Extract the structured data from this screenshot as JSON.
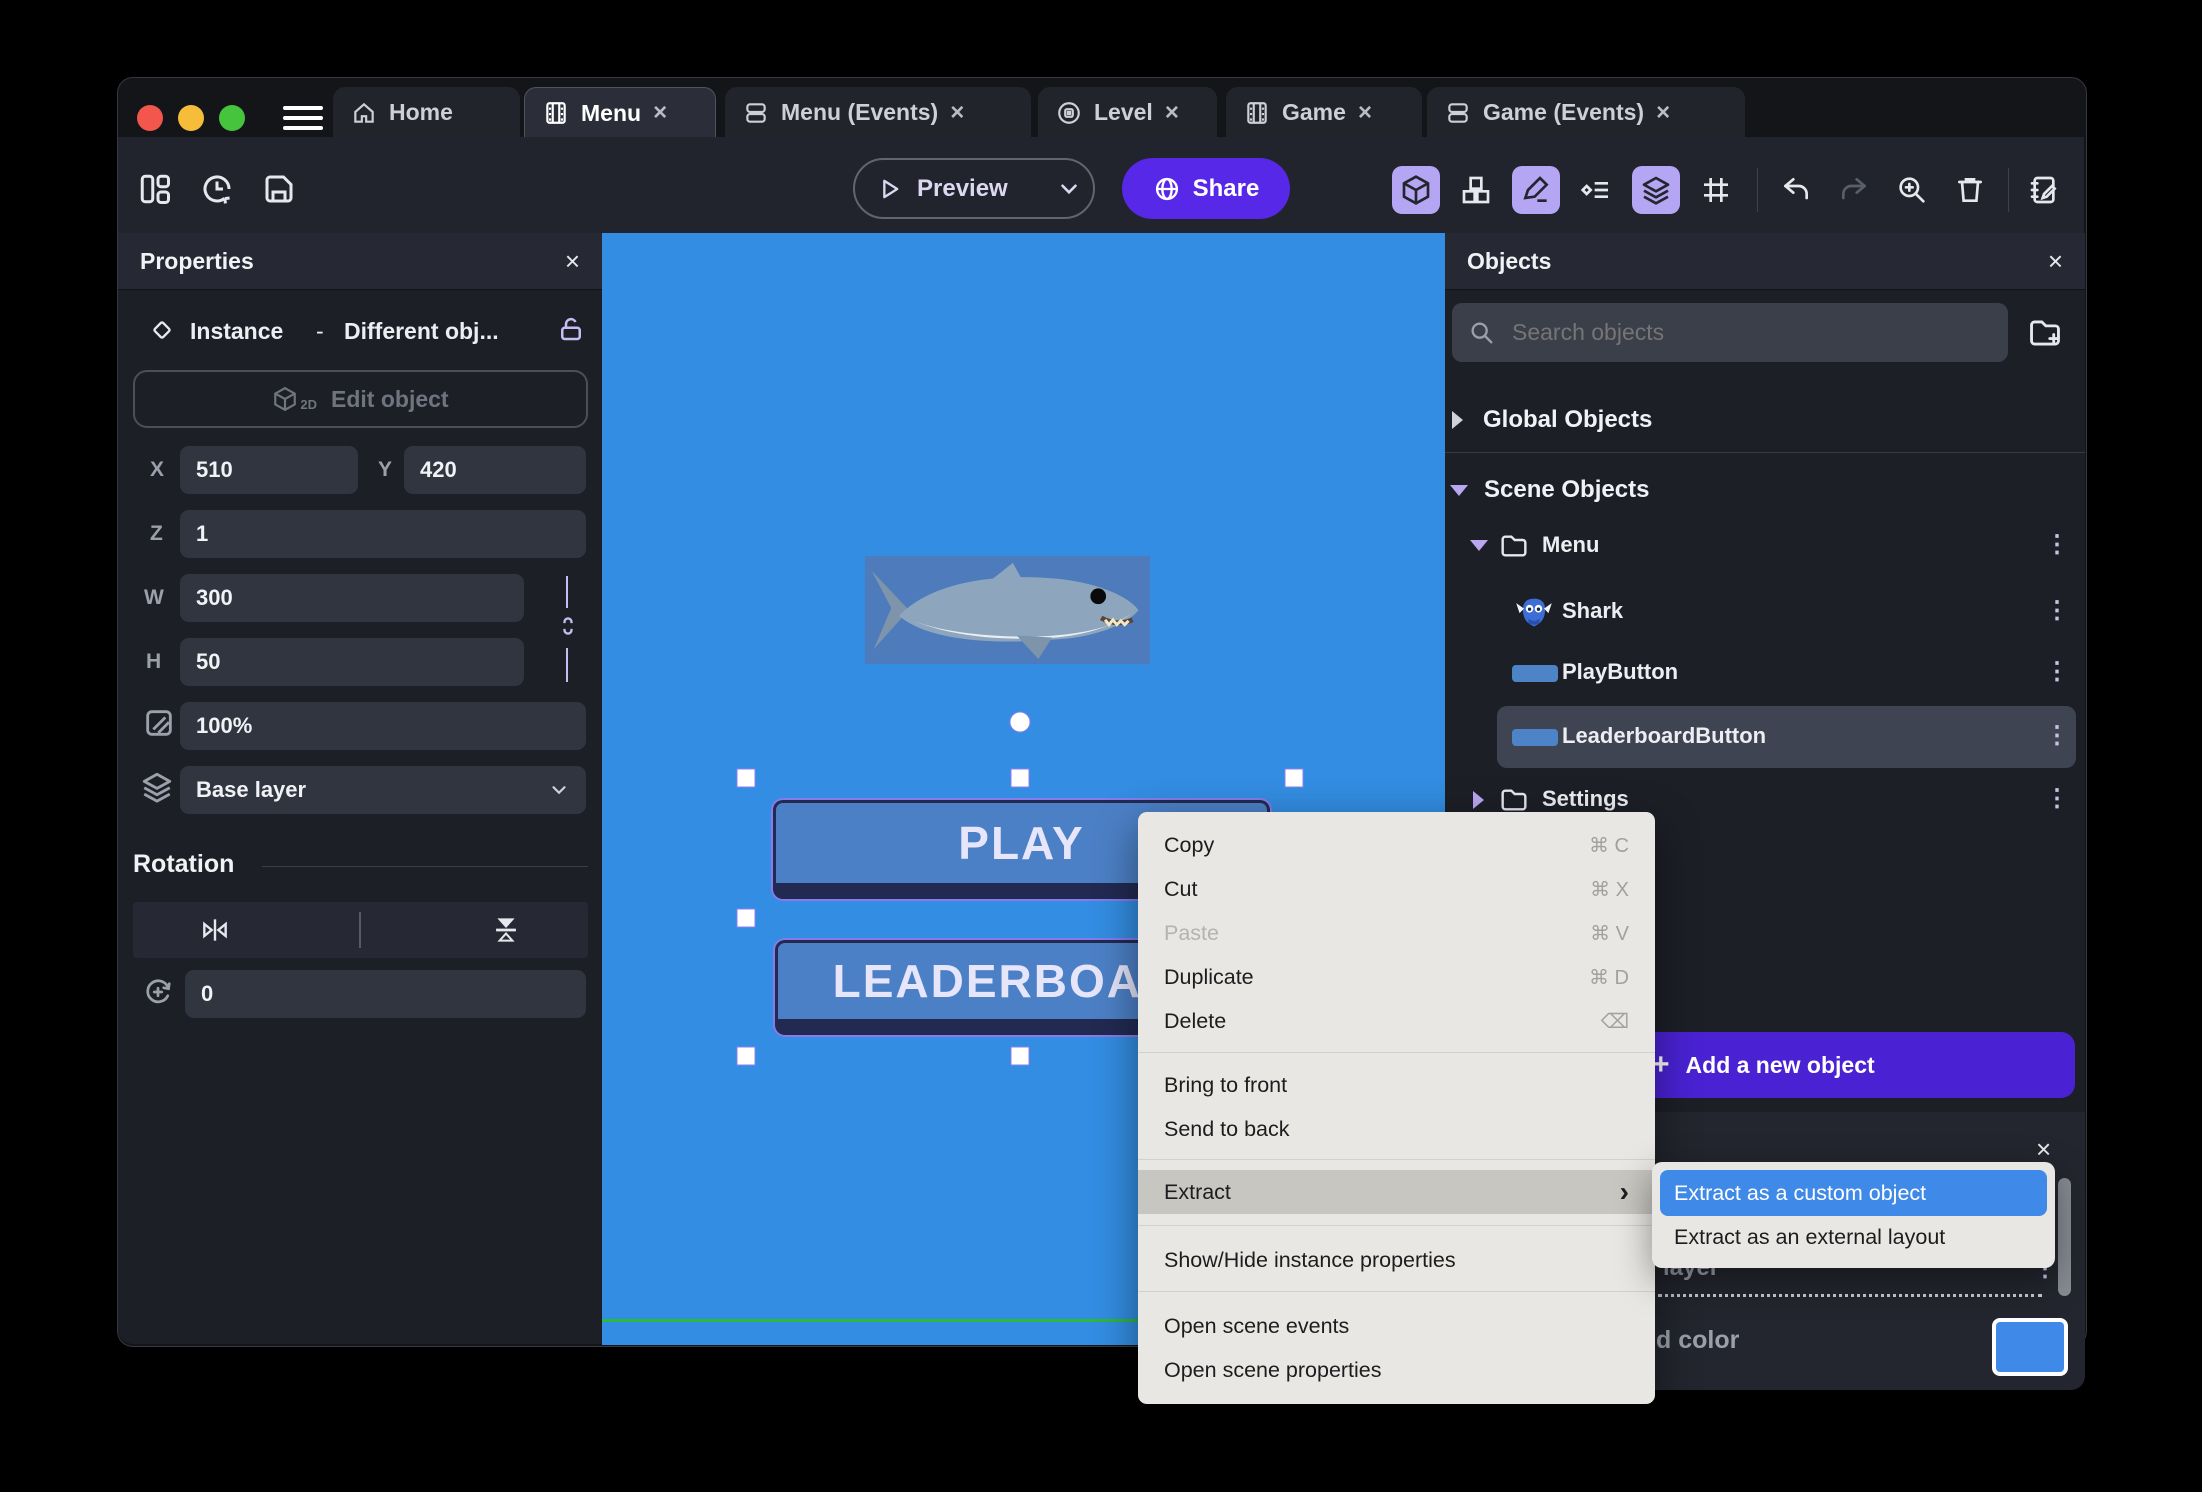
{
  "icons": {
    "close": "×",
    "kebab": "⋮",
    "arrow_right": "›",
    "plus": "+"
  },
  "titlebar": {
    "tabs": [
      {
        "label": "Home"
      },
      {
        "label": "Menu"
      },
      {
        "label": "Menu (Events)"
      },
      {
        "label": "Level"
      },
      {
        "label": "Game"
      },
      {
        "label": "Game (Events)"
      }
    ]
  },
  "toolbar": {
    "preview_label": "Preview",
    "share_label": "Share"
  },
  "properties": {
    "title": "Properties",
    "instance_label": "Instance",
    "instance_sep": "-",
    "instance_object": "Different obj...",
    "edit_object_label": "Edit object",
    "edit_object_badge": "2D",
    "x_label": "X",
    "x_value": "510",
    "y_label": "Y",
    "y_value": "420",
    "z_label": "Z",
    "z_value": "1",
    "w_label": "W",
    "w_value": "300",
    "h_label": "H",
    "h_value": "50",
    "opacity_value": "100%",
    "layer_value": "Base layer",
    "rotation_heading": "Rotation",
    "rotation_value": "0"
  },
  "canvas": {
    "play_label": "PLAY",
    "leaderboard_label": "LEADERBOARD"
  },
  "objects": {
    "title": "Objects",
    "search_placeholder": "Search objects",
    "global_header": "Global Objects",
    "scene_header": "Scene Objects",
    "tree": [
      {
        "label": "Menu"
      },
      {
        "label": "Shark"
      },
      {
        "label": "PlayButton"
      },
      {
        "label": "LeaderboardButton"
      },
      {
        "label": "Settings"
      }
    ],
    "add_button_label": "Add a new object"
  },
  "context_menu": {
    "items": [
      {
        "label": "Copy",
        "shortcut": "⌘ C"
      },
      {
        "label": "Cut",
        "shortcut": "⌘ X"
      },
      {
        "label": "Paste",
        "shortcut": "⌘ V"
      },
      {
        "label": "Duplicate",
        "shortcut": "⌘ D"
      },
      {
        "label": "Delete",
        "shortcut": "⌫"
      },
      {
        "label": "Bring to front",
        "shortcut": ""
      },
      {
        "label": "Send to back",
        "shortcut": ""
      },
      {
        "label": "Extract",
        "shortcut": ""
      },
      {
        "label": "Show/Hide instance properties",
        "shortcut": ""
      },
      {
        "label": "Open scene events",
        "shortcut": ""
      },
      {
        "label": "Open scene properties",
        "shortcut": ""
      }
    ]
  },
  "extract_submenu": {
    "items": [
      {
        "label": "Extract as a custom object"
      },
      {
        "label": "Extract as an external layout"
      }
    ]
  },
  "layers_panel": {
    "layer_text": "layer",
    "color_text": "d color",
    "swatch_color": "#3f8ae8"
  }
}
